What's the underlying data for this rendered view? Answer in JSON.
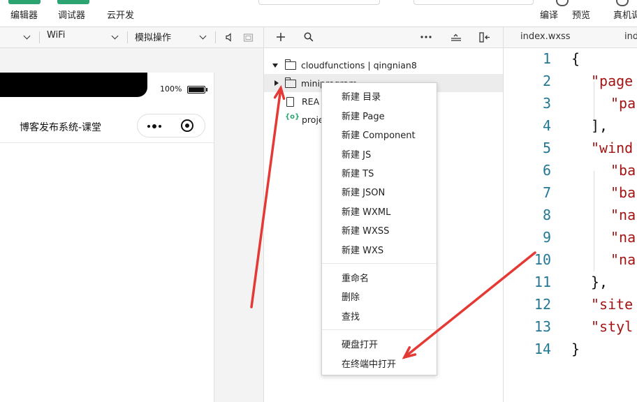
{
  "toolbar": {
    "left_buttons": [
      "编辑器",
      "调试器",
      "云开发"
    ],
    "right_buttons": [
      "编译",
      "预览",
      "真机调"
    ],
    "accent": "#2ba471"
  },
  "simulator": {
    "device_menu": "",
    "network": "WiFi",
    "operation": "模拟操作",
    "battery_percent": "100%",
    "page_title": "博客发布系统-课堂"
  },
  "explorer": {
    "tree": [
      {
        "label": "cloudfunctions | qingnian8",
        "expanded": true
      },
      {
        "label": "miniprogram",
        "expanded": false
      },
      {
        "label": "REA"
      },
      {
        "label": "proje"
      }
    ]
  },
  "context_menu": {
    "group1": [
      "新建 目录",
      "新建 Page",
      "新建 Component",
      "新建 JS",
      "新建 TS",
      "新建 JSON",
      "新建 WXML",
      "新建 WXSS",
      "新建 WXS"
    ],
    "group2": [
      "重命名",
      "删除",
      "查找"
    ],
    "group3": [
      "硬盘打开",
      "在终端中打开"
    ]
  },
  "editor": {
    "tabs": [
      "index.wxss",
      "ind"
    ],
    "line_numbers": [
      "1",
      "2",
      "3",
      "4",
      "5",
      "6",
      "7",
      "8",
      "9",
      "10",
      "11",
      "12",
      "13",
      "14"
    ],
    "lines": [
      {
        "text": "{",
        "string": false
      },
      {
        "text": "\"page",
        "string": true
      },
      {
        "text": "\"pa",
        "string": true
      },
      {
        "text": "],",
        "string": false
      },
      {
        "text": "\"wind",
        "string": true
      },
      {
        "text": "\"ba",
        "string": true
      },
      {
        "text": "\"ba",
        "string": true
      },
      {
        "text": "\"na",
        "string": true
      },
      {
        "text": "\"na",
        "string": true
      },
      {
        "text": "\"na",
        "string": true
      },
      {
        "text": "},",
        "string": false
      },
      {
        "text": "\"site",
        "string": true
      },
      {
        "text": "\"styl",
        "string": true
      },
      {
        "text": "}",
        "string": false
      }
    ]
  },
  "annotation_color": "#e53935"
}
